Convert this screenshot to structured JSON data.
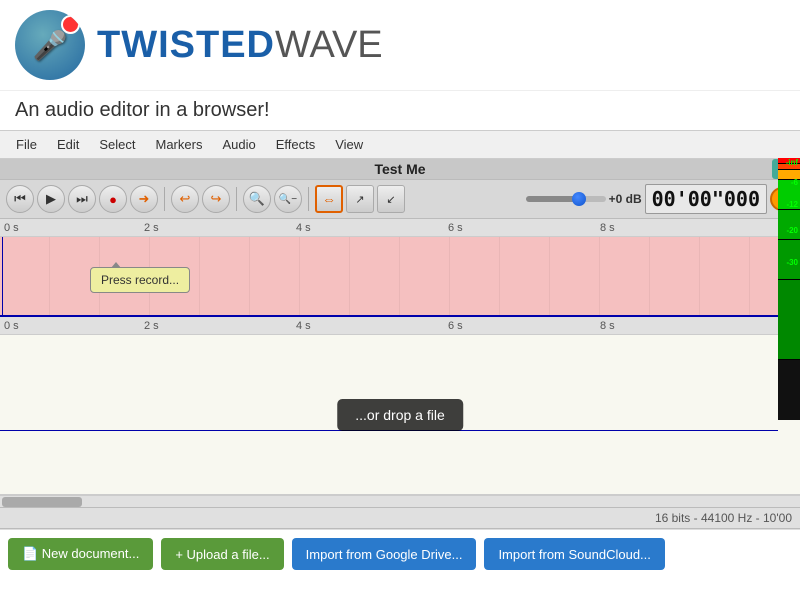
{
  "header": {
    "logo_text_bold": "TWISTED",
    "logo_text_normal": "WAVE",
    "tagline": "An audio editor in a browser!"
  },
  "menubar": {
    "items": [
      "File",
      "Edit",
      "Select",
      "Markers",
      "Audio",
      "Effects",
      "View"
    ]
  },
  "toolbar": {
    "track_name": "Test Me",
    "time_display": "00'00\"000",
    "db_label": "+0 dB",
    "volume_pct": 60
  },
  "tooltip": {
    "text": "Press record..."
  },
  "waveform": {
    "top_timeline_marks": [
      "0 s",
      "2 s",
      "4 s",
      "6 s",
      "8 s"
    ],
    "bottom_timeline_marks": [
      "0 s",
      "2 s",
      "4 s",
      "6 s",
      "8 s"
    ],
    "drop_hint": "...or drop a file"
  },
  "vu_meter": {
    "labels": [
      "-inf",
      "-6",
      "-12",
      "-20",
      "-30"
    ],
    "label_positions": [
      0,
      20,
      40,
      60,
      80
    ]
  },
  "statusbar": {
    "text": "16 bits - 44100 Hz - 10'00"
  },
  "bottom_buttons": [
    {
      "id": "new-doc",
      "label": "New document...",
      "icon": "📄",
      "color": "green"
    },
    {
      "id": "upload",
      "label": "+ Upload a file...",
      "icon": "",
      "color": "green"
    },
    {
      "id": "gdrive",
      "label": "Import from Google Drive...",
      "icon": "",
      "color": "blue"
    },
    {
      "id": "soundcloud",
      "label": "Import from SoundCloud...",
      "icon": "",
      "color": "blue"
    }
  ]
}
